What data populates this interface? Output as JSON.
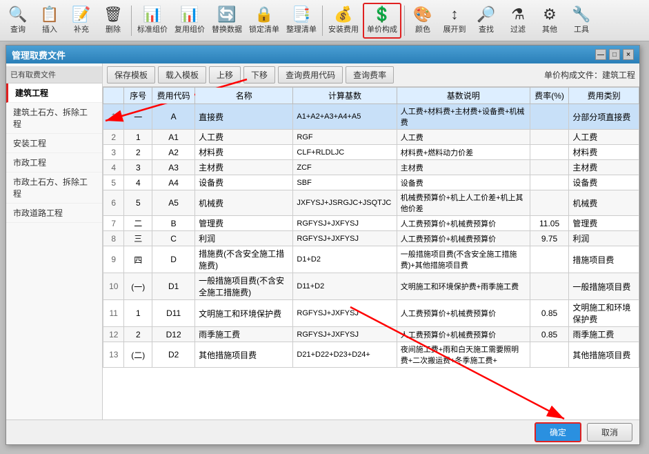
{
  "toolbar": {
    "title": "管理取费文件",
    "items": [
      {
        "label": "查询",
        "icon": "🔍",
        "name": "query"
      },
      {
        "label": "插入",
        "icon": "📋",
        "name": "insert"
      },
      {
        "label": "补充",
        "icon": "📝",
        "name": "supplement"
      },
      {
        "label": "删除",
        "icon": "🗑",
        "name": "delete"
      },
      {
        "label": "标准组价",
        "icon": "📊",
        "name": "standard-group"
      },
      {
        "label": "复用组价",
        "icon": "📊",
        "name": "reuse-group"
      },
      {
        "label": "替换数据",
        "icon": "🔄",
        "name": "replace-data"
      },
      {
        "label": "锁定清单",
        "icon": "🔒",
        "name": "lock-list"
      },
      {
        "label": "整理清单",
        "icon": "📑",
        "name": "sort-list"
      },
      {
        "label": "安装费用",
        "icon": "💰",
        "name": "install-cost"
      },
      {
        "label": "单价构成",
        "icon": "💲",
        "name": "unit-price-comp",
        "active": true
      },
      {
        "label": "颜色",
        "icon": "🎨",
        "name": "color"
      },
      {
        "label": "展开到",
        "icon": "↕",
        "name": "expand-to"
      },
      {
        "label": "查找",
        "icon": "🔎",
        "name": "find"
      },
      {
        "label": "过滤",
        "icon": "⚗",
        "name": "filter"
      },
      {
        "label": "其他",
        "icon": "⚙",
        "name": "other"
      },
      {
        "label": "工具",
        "icon": "🔧",
        "name": "tools"
      }
    ]
  },
  "dialog": {
    "title": "管理取费文件",
    "close_btn": "×",
    "min_btn": "—",
    "max_btn": "□"
  },
  "sidebar": {
    "label": "已有取费文件",
    "items": [
      {
        "label": "建筑工程",
        "selected": true
      },
      {
        "label": "建筑土石方、拆除工程"
      },
      {
        "label": "安装工程"
      },
      {
        "label": "市政工程"
      },
      {
        "label": "市政土石方、拆除工程"
      },
      {
        "label": "市政道路工程"
      }
    ]
  },
  "content_toolbar": {
    "save_template": "保存模板",
    "load_template": "载入模板",
    "move_up": "上移",
    "move_down": "下移",
    "query_cost_code": "查询费用代码",
    "query_rate": "查询费率",
    "info_label": "单价构成文件：建筑工程"
  },
  "table": {
    "headers": [
      "序号",
      "费用代码",
      "名称",
      "计算基数",
      "基数说明",
      "费率(%)",
      "费用类别"
    ],
    "rows": [
      {
        "no": "1",
        "seq": "一",
        "code": "A",
        "name": "直接费",
        "base": "A1+A2+A3+A4+A5",
        "base_desc": "人工费+材料费+主材费+设备费+机械费",
        "rate": "",
        "type": "分部分项直接费"
      },
      {
        "no": "2",
        "seq": "1",
        "code": "A1",
        "name": "人工费",
        "base": "RGF",
        "base_desc": "人工费",
        "rate": "",
        "type": "人工费"
      },
      {
        "no": "3",
        "seq": "2",
        "code": "A2",
        "name": "材料费",
        "base": "CLF+RLDLJC",
        "base_desc": "材料费+燃料动力价差",
        "rate": "",
        "type": "材料费"
      },
      {
        "no": "4",
        "seq": "3",
        "code": "A3",
        "name": "主材费",
        "base": "ZCF",
        "base_desc": "主材费",
        "rate": "",
        "type": "主材费"
      },
      {
        "no": "5",
        "seq": "4",
        "code": "A4",
        "name": "设备费",
        "base": "SBF",
        "base_desc": "设备费",
        "rate": "",
        "type": "设备费"
      },
      {
        "no": "6",
        "seq": "5",
        "code": "A5",
        "name": "机械费",
        "base": "JXFYSJ+JSRGJC+JSQTJC",
        "base_desc": "机械费预算价+机上人工价差+机上其他价差",
        "rate": "",
        "type": "机械费"
      },
      {
        "no": "7",
        "seq": "二",
        "code": "B",
        "name": "管理费",
        "base": "RGFYSJ+JXFYSJ",
        "base_desc": "人工费预算价+机械费预算价",
        "rate": "11.05",
        "type": "管理费"
      },
      {
        "no": "8",
        "seq": "三",
        "code": "C",
        "name": "利润",
        "base": "RGFYSJ+JXFYSJ",
        "base_desc": "人工费预算价+机械费预算价",
        "rate": "9.75",
        "type": "利润"
      },
      {
        "no": "9",
        "seq": "四",
        "code": "D",
        "name": "措施费(不含安全施工措施费)",
        "base": "D1+D2",
        "base_desc": "一般措施项目费(不含安全施工措施费)+其他措施项目费",
        "rate": "",
        "type": "措施项目费"
      },
      {
        "no": "10",
        "seq": "(一)",
        "code": "D1",
        "name": "一般措施项目费(不含安全施工措施费)",
        "base": "D11+D2",
        "base_desc": "文明施工和环境保护费+雨季施工费",
        "rate": "",
        "type": "一般措施项目费"
      },
      {
        "no": "11",
        "seq": "1",
        "code": "D11",
        "name": "文明施工和环境保护费",
        "base": "RGFYSJ+JXFYSJ",
        "base_desc": "人工费预算价+机械费预算价",
        "rate": "0.85",
        "type": "文明施工和环境保护费"
      },
      {
        "no": "12",
        "seq": "2",
        "code": "D12",
        "name": "雨季施工费",
        "base": "RGFYSJ+JXFYSJ",
        "base_desc": "人工费预算价+机械费预算价",
        "rate": "0.85",
        "type": "雨季施工费"
      },
      {
        "no": "13",
        "seq": "(二)",
        "code": "D2",
        "name": "其他措施项目费",
        "base": "D21+D22+D23+D24+",
        "base_desc": "夜间施工费+雨和白天施工需要照明费+二次搬运费+冬季施工费+",
        "rate": "",
        "type": "其他措施项目费"
      }
    ]
  },
  "footer": {
    "confirm": "确定",
    "cancel": "取消"
  }
}
